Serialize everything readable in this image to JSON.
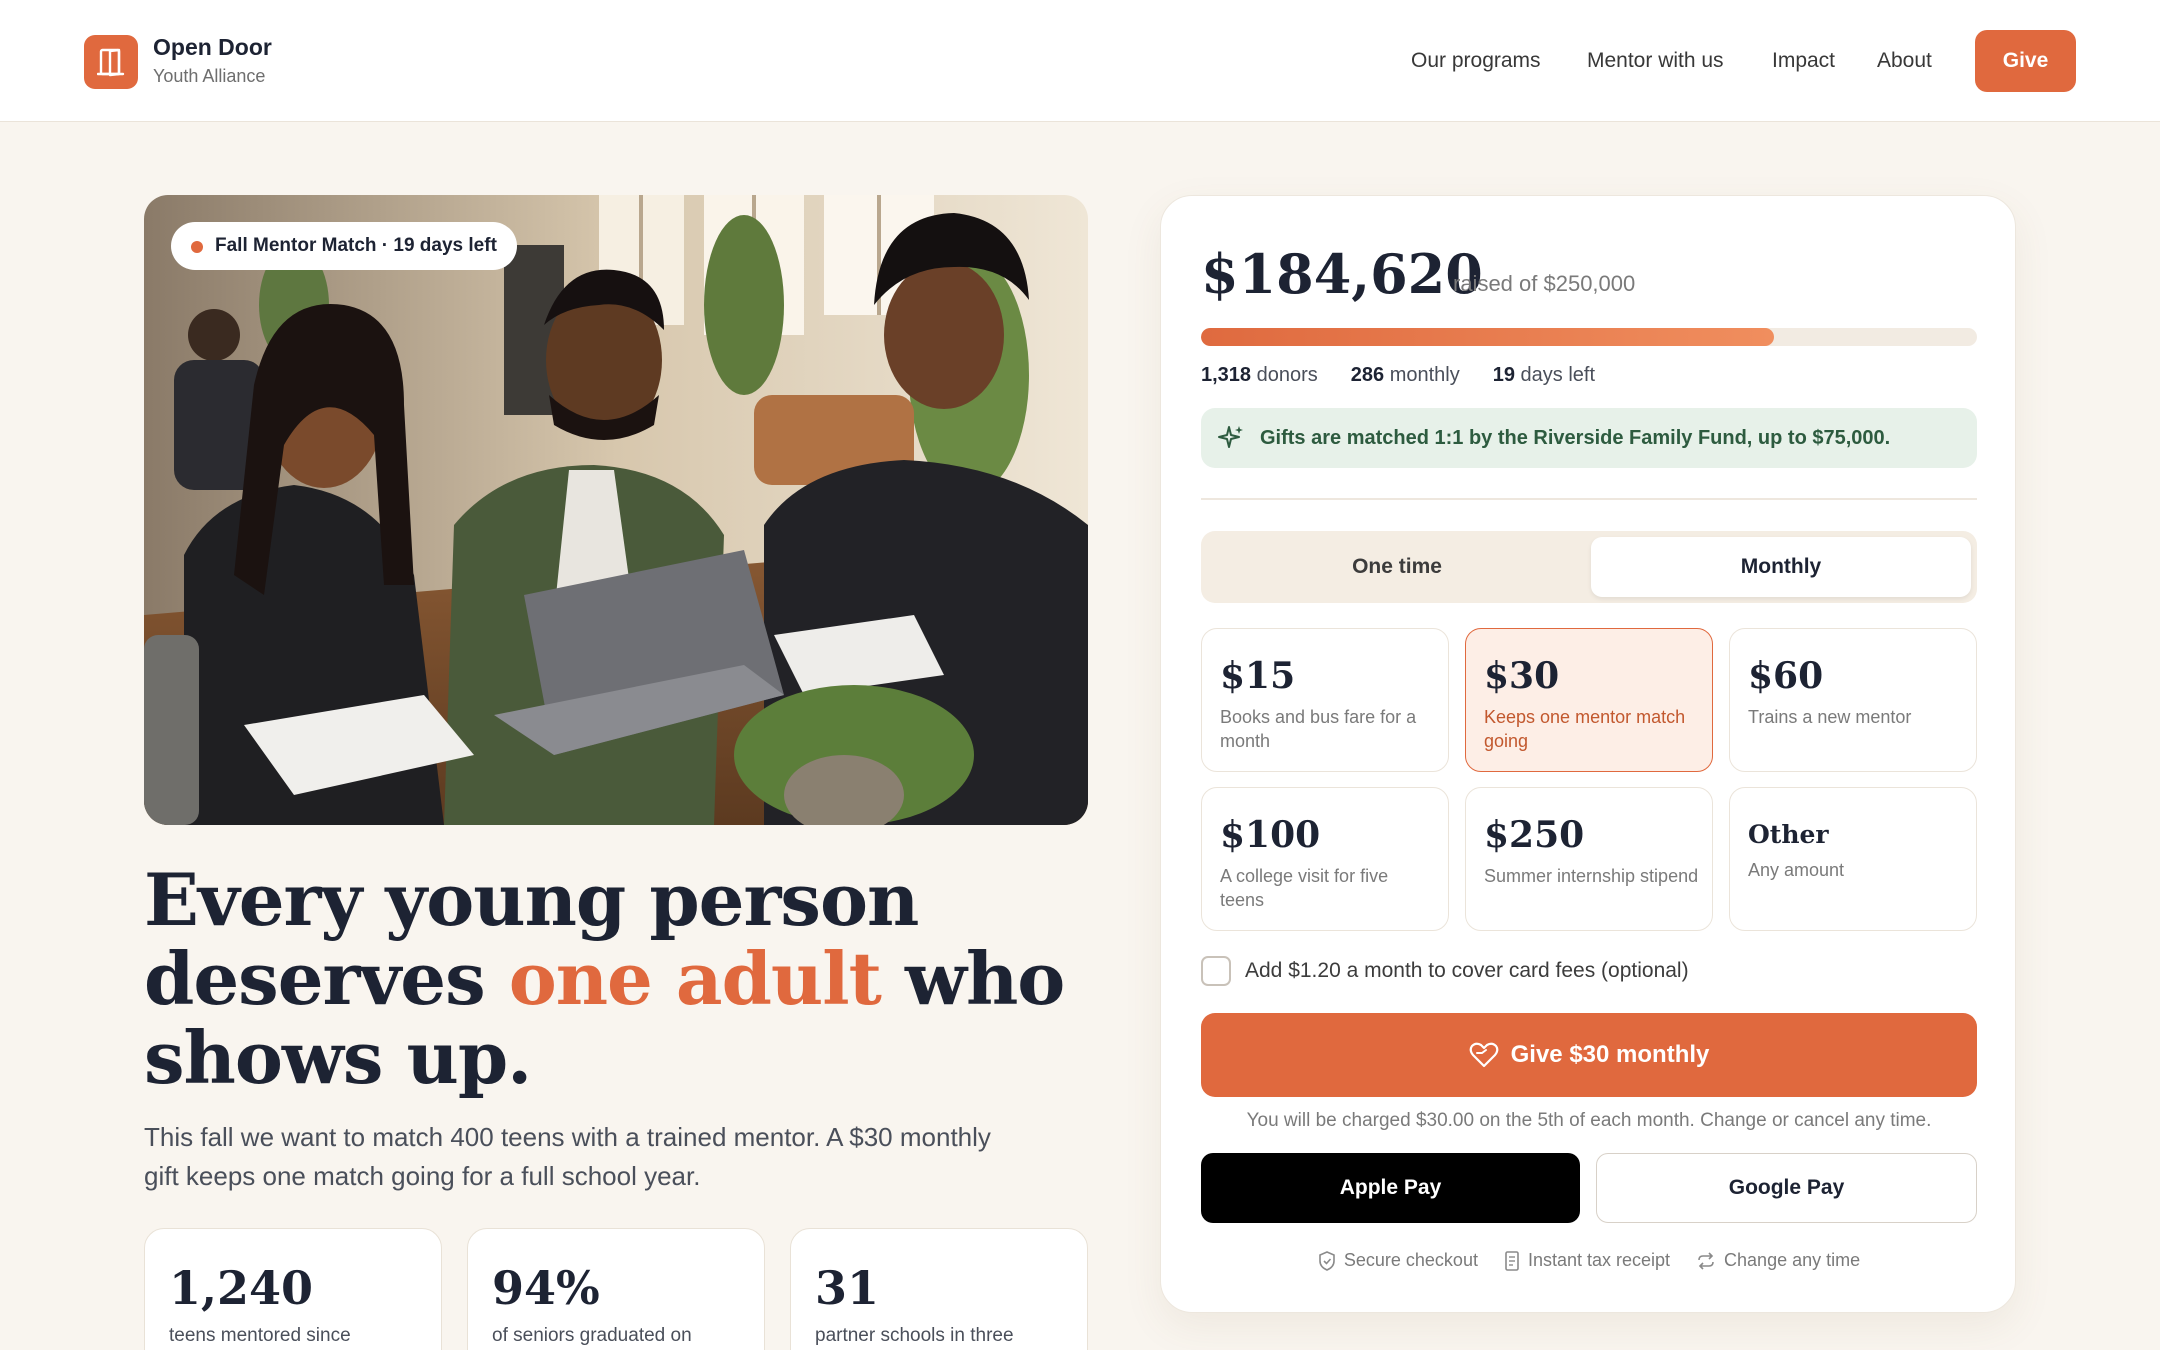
{
  "header": {
    "brand_name": "Open Door",
    "brand_sub": "Youth Alliance",
    "logo_icon": "door-icon",
    "nav": [
      "Our programs",
      "Mentor with us",
      "Impact",
      "About"
    ],
    "give_label": "Give"
  },
  "hero": {
    "badge": "Fall Mentor Match · 19 days left",
    "headline_1": "Every young person",
    "headline_2a": "deserves ",
    "headline_accent": "one adult",
    "headline_2b": " who",
    "headline_3": "shows up.",
    "intro": "This fall we want to match 400 teens with a trained mentor. A $30 monthly gift keeps one match going for a full school year."
  },
  "stats": [
    {
      "num": "1,240",
      "label": "teens mentored since"
    },
    {
      "num": "94%",
      "label": "of seniors graduated on"
    },
    {
      "num": "31",
      "label": "partner schools in three"
    }
  ],
  "donate": {
    "raised": "$184,620",
    "goal_text": "raised of $250,000",
    "progress_fraction": 0.738,
    "donors_count": "1,318",
    "donors_label": " donors",
    "monthly_count": "286",
    "monthly_label": " monthly",
    "days_count": "19",
    "days_label": " days left",
    "match_text": "Gifts are matched 1:1 by the Riverside Family Fund, up to $75,000.",
    "toggle": {
      "one_time": "One time",
      "monthly": "Monthly",
      "selected": "monthly"
    },
    "tiers": [
      {
        "amount": "$15",
        "desc": "Books and bus fare for a month"
      },
      {
        "amount": "$30",
        "desc": "Keeps one mentor match going",
        "selected": true
      },
      {
        "amount": "$60",
        "desc": "Trains a new mentor"
      },
      {
        "amount": "$100",
        "desc": "A college visit for five teens"
      },
      {
        "amount": "$250",
        "desc": "Summer internship stipend"
      },
      {
        "amount": "Other",
        "desc": "Any amount"
      }
    ],
    "fee_label": "Add $1.20 a month to cover card fees (optional)",
    "cta_label": "Give $30 monthly",
    "charge_note": "You will be charged $30.00 on the 5th of each month. Change or cancel any time.",
    "apple_pay": "Apple Pay",
    "google_pay": "Google Pay",
    "trust": [
      "Secure checkout",
      "Instant tax receipt",
      "Change any time"
    ]
  },
  "colors": {
    "accent": "#e0693e",
    "match_bg": "#e7f1e9",
    "match_text": "#2d5b3f",
    "page_bg": "#f9f5ef"
  }
}
